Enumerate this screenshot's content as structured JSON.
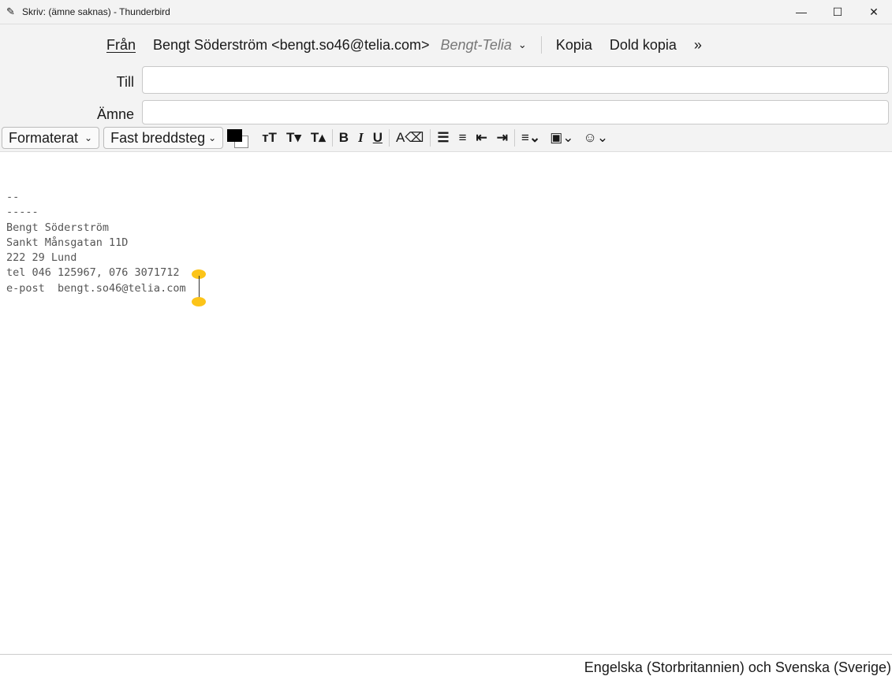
{
  "window": {
    "title": "Skriv: (ämne saknas) - Thunderbird",
    "minimize": "—",
    "maximize": "☐",
    "close": "✕"
  },
  "header": {
    "from_label": "Från",
    "from_value": "Bengt Söderström <bengt.so46@telia.com>",
    "identity": "Bengt-Telia",
    "cc": "Kopia",
    "bcc": "Dold kopia",
    "more": "»",
    "to_label": "Till",
    "to_value": "",
    "subject_label": "Ämne",
    "subject_value": ""
  },
  "toolbar": {
    "paragraph_format": "Formaterat",
    "font": "Fast breddsteg",
    "text_color": "#000000",
    "bg_color": "#ffffff"
  },
  "body_lines": [
    "--",
    "-----",
    "Bengt Söderström",
    "Sankt Månsgatan 11D",
    "222 29 Lund",
    "tel 046 125967, 076 3071712",
    "e-post  bengt.so46@telia.com"
  ],
  "status": {
    "language": "Engelska (Storbritannien) och Svenska (Sverige)"
  }
}
